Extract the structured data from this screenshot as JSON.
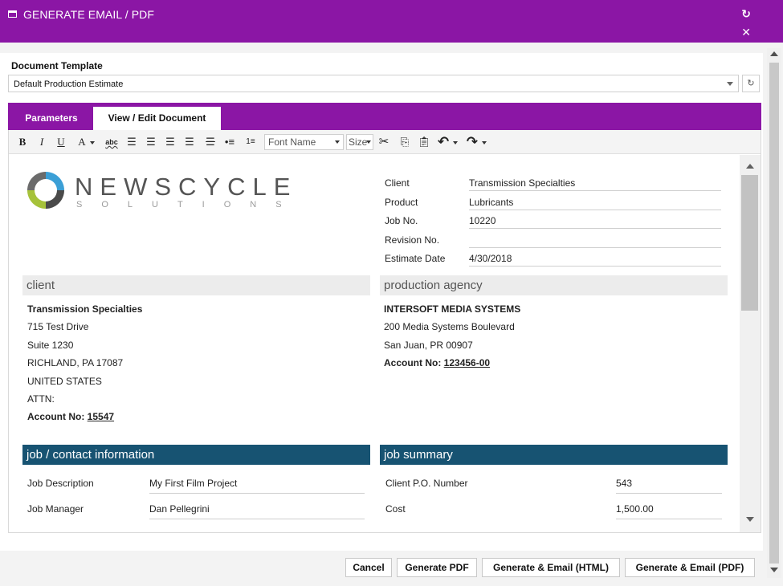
{
  "window": {
    "title": "GENERATE EMAIL / PDF",
    "icons": {
      "window": "window-icon",
      "refresh": "refresh-icon",
      "close": "close-icon"
    }
  },
  "template": {
    "label": "Document Template",
    "selected": "Default Production Estimate"
  },
  "tabs": [
    {
      "label": "Parameters",
      "active": false
    },
    {
      "label": "View / Edit Document",
      "active": true
    }
  ],
  "toolbar": {
    "bold": "B",
    "italic": "I",
    "underline": "U",
    "font_color": "A",
    "spellcheck": "abc",
    "font_placeholder": "Font Name",
    "size_placeholder": "Size"
  },
  "document": {
    "logo": {
      "word": "NEWSCYCLE",
      "sub": "SOLUTIONS",
      "colors": {
        "blue": "#3b9fd6",
        "green": "#a6c23a",
        "gray": "#555555"
      }
    },
    "meta": [
      {
        "label": "Client",
        "value": "Transmission Specialties"
      },
      {
        "label": "Product",
        "value": "Lubricants"
      },
      {
        "label": "Job No.",
        "value": "10220"
      },
      {
        "label": "Revision No.",
        "value": ""
      },
      {
        "label": "Estimate Date",
        "value": "4/30/2018"
      }
    ],
    "client": {
      "heading": "client",
      "name": "Transmission Specialties",
      "line1": "715 Test Drive",
      "line2": "Suite 1230",
      "line3": "RICHLAND, PA 17087",
      "line4": "UNITED STATES",
      "attn": "ATTN:",
      "account_label": "Account No:",
      "account_no": "15547"
    },
    "agency": {
      "heading": "production agency",
      "name": "INTERSOFT MEDIA SYSTEMS",
      "line1": "200 Media Systems Boulevard",
      "line2": "San Juan, PR 00907",
      "account_label": "Account No:",
      "account_no": "123456-00"
    },
    "job_contact": {
      "heading": "job / contact information",
      "rows": [
        {
          "label": "Job Description",
          "value": "My First Film Project"
        },
        {
          "label": "Job Manager",
          "value": "Dan Pellegrini"
        }
      ]
    },
    "job_summary": {
      "heading": "job summary",
      "rows": [
        {
          "label": "Client P.O. Number",
          "value": "543"
        },
        {
          "label": "Cost",
          "value": "1,500.00"
        }
      ]
    }
  },
  "footer": {
    "cancel": "Cancel",
    "generate_pdf": "Generate PDF",
    "generate_email_html": "Generate & Email (HTML)",
    "generate_email_pdf": "Generate & Email (PDF)"
  },
  "colors": {
    "brand_purple": "#8b16a5",
    "section_blue": "#175372"
  }
}
